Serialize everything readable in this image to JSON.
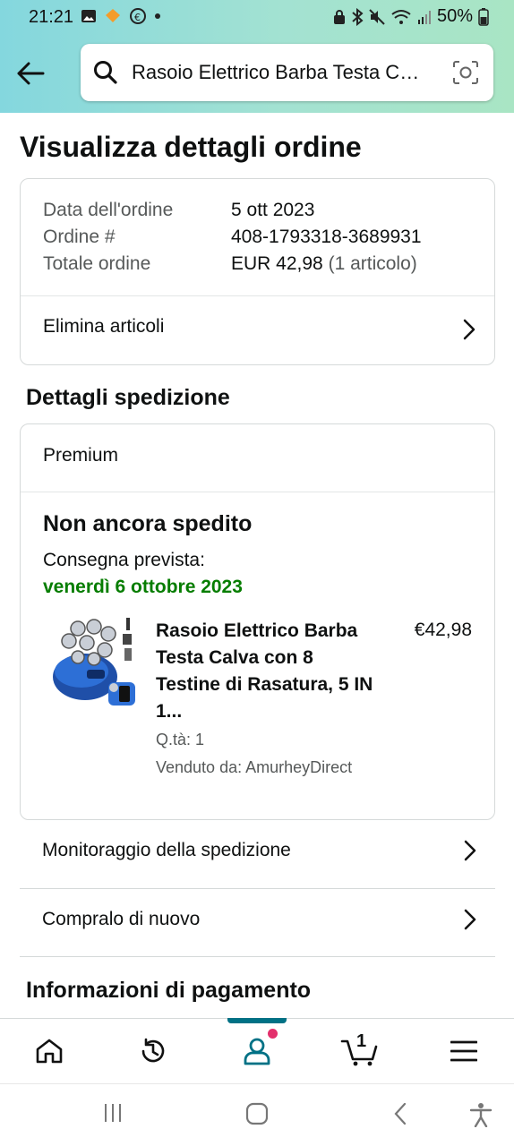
{
  "status_bar": {
    "time": "21:21",
    "battery_pct": "50%"
  },
  "search": {
    "query": "Rasoio Elettrico Barba Testa Calva con 8 Testine"
  },
  "page": {
    "title": "Visualizza dettagli ordine"
  },
  "order_summary": {
    "date_label": "Data dell'ordine",
    "date_value": "5 ott 2023",
    "number_label": "Ordine #",
    "number_value": "408-1793318-3689931",
    "total_label": "Totale ordine",
    "total_value": "EUR 42,98",
    "total_items": "(1 articolo)",
    "delete_items_label": "Elimina articoli"
  },
  "shipping": {
    "section_title": "Dettagli spedizione",
    "shipping_type": "Premium",
    "status_title": "Non ancora spedito",
    "delivery_label": "Consegna prevista:",
    "delivery_date": "venerdì 6 ottobre 2023",
    "item": {
      "title": "Rasoio Elettrico Barba Testa Calva con 8 Testine di Rasatura, 5 IN 1...",
      "price": "€42,98",
      "quantity": "Q.tà: 1",
      "seller": "Venduto da: AmurheyDirect"
    }
  },
  "actions": {
    "track_label": "Monitoraggio della spedizione",
    "buy_again_label": "Compralo di nuovo"
  },
  "payment": {
    "section_title": "Informazioni di pagamento"
  },
  "bottom_nav": {
    "items": [
      "home-icon",
      "history-icon",
      "account-icon",
      "cart-icon",
      "menu-icon"
    ],
    "active": "account-icon",
    "cart_count": "1",
    "accent_color": "#007185"
  },
  "colors": {
    "delivery_green": "#067d00",
    "notification_dot": "#e3306c"
  }
}
